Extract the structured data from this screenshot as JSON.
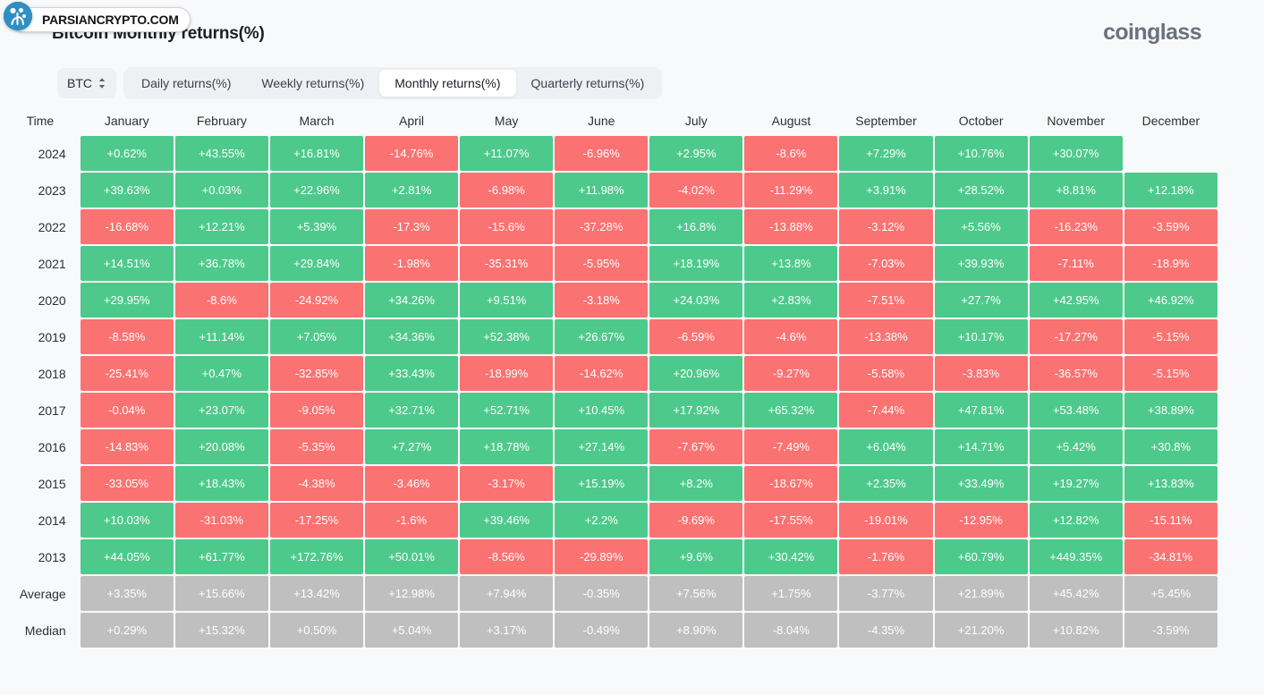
{
  "header": {
    "title": "Bitcoin Monthly returns(%)",
    "brand": "coinglass"
  },
  "watermark": {
    "text": "PARSIANCRYPTO.COM",
    "logo_icon": "tree-circle-icon"
  },
  "controls": {
    "asset": "BTC",
    "asset_chevron_icon": "chevron-up-down-icon",
    "tabs": [
      {
        "label": "Daily returns(%)",
        "active": false
      },
      {
        "label": "Weekly returns(%)",
        "active": false
      },
      {
        "label": "Monthly returns(%)",
        "active": true
      },
      {
        "label": "Quarterly returns(%)",
        "active": false
      }
    ]
  },
  "colors": {
    "positive": "#4ec98c",
    "negative": "#fa7272",
    "summary": "#bfbfbf",
    "background": "#f8f9fa",
    "text": "#2b3038"
  },
  "chart_data": {
    "type": "heatmap",
    "title": "Bitcoin Monthly returns(%)",
    "xlabel": "",
    "ylabel": "Time",
    "time_header": "Time",
    "categories": [
      "January",
      "February",
      "March",
      "April",
      "May",
      "June",
      "July",
      "August",
      "September",
      "October",
      "November",
      "December"
    ],
    "rows": [
      {
        "label": "2024",
        "kind": "year",
        "values": [
          "+0.62%",
          "+43.55%",
          "+16.81%",
          "-14.76%",
          "+11.07%",
          "-6.96%",
          "+2.95%",
          "-8.6%",
          "+7.29%",
          "+10.76%",
          "+30.07%",
          ""
        ]
      },
      {
        "label": "2023",
        "kind": "year",
        "values": [
          "+39.63%",
          "+0.03%",
          "+22.96%",
          "+2.81%",
          "-6.98%",
          "+11.98%",
          "-4.02%",
          "-11.29%",
          "+3.91%",
          "+28.52%",
          "+8.81%",
          "+12.18%"
        ]
      },
      {
        "label": "2022",
        "kind": "year",
        "values": [
          "-16.68%",
          "+12.21%",
          "+5.39%",
          "-17.3%",
          "-15.6%",
          "-37.28%",
          "+16.8%",
          "-13.88%",
          "-3.12%",
          "+5.56%",
          "-16.23%",
          "-3.59%"
        ]
      },
      {
        "label": "2021",
        "kind": "year",
        "values": [
          "+14.51%",
          "+36.78%",
          "+29.84%",
          "-1.98%",
          "-35.31%",
          "-5.95%",
          "+18.19%",
          "+13.8%",
          "-7.03%",
          "+39.93%",
          "-7.11%",
          "-18.9%"
        ]
      },
      {
        "label": "2020",
        "kind": "year",
        "values": [
          "+29.95%",
          "-8.6%",
          "-24.92%",
          "+34.26%",
          "+9.51%",
          "-3.18%",
          "+24.03%",
          "+2.83%",
          "-7.51%",
          "+27.7%",
          "+42.95%",
          "+46.92%"
        ]
      },
      {
        "label": "2019",
        "kind": "year",
        "values": [
          "-8.58%",
          "+11.14%",
          "+7.05%",
          "+34.36%",
          "+52.38%",
          "+26.67%",
          "-6.59%",
          "-4.6%",
          "-13.38%",
          "+10.17%",
          "-17.27%",
          "-5.15%"
        ]
      },
      {
        "label": "2018",
        "kind": "year",
        "values": [
          "-25.41%",
          "+0.47%",
          "-32.85%",
          "+33.43%",
          "-18.99%",
          "-14.62%",
          "+20.96%",
          "-9.27%",
          "-5.58%",
          "-3.83%",
          "-36.57%",
          "-5.15%"
        ]
      },
      {
        "label": "2017",
        "kind": "year",
        "values": [
          "-0.04%",
          "+23.07%",
          "-9.05%",
          "+32.71%",
          "+52.71%",
          "+10.45%",
          "+17.92%",
          "+65.32%",
          "-7.44%",
          "+47.81%",
          "+53.48%",
          "+38.89%"
        ]
      },
      {
        "label": "2016",
        "kind": "year",
        "values": [
          "-14.83%",
          "+20.08%",
          "-5.35%",
          "+7.27%",
          "+18.78%",
          "+27.14%",
          "-7.67%",
          "-7.49%",
          "+6.04%",
          "+14.71%",
          "+5.42%",
          "+30.8%"
        ]
      },
      {
        "label": "2015",
        "kind": "year",
        "values": [
          "-33.05%",
          "+18.43%",
          "-4.38%",
          "-3.46%",
          "-3.17%",
          "+15.19%",
          "+8.2%",
          "-18.67%",
          "+2.35%",
          "+33.49%",
          "+19.27%",
          "+13.83%"
        ]
      },
      {
        "label": "2014",
        "kind": "year",
        "values": [
          "+10.03%",
          "-31.03%",
          "-17.25%",
          "-1.6%",
          "+39.46%",
          "+2.2%",
          "-9.69%",
          "-17.55%",
          "-19.01%",
          "-12.95%",
          "+12.82%",
          "-15.11%"
        ]
      },
      {
        "label": "2013",
        "kind": "year",
        "values": [
          "+44.05%",
          "+61.77%",
          "+172.76%",
          "+50.01%",
          "-8.56%",
          "-29.89%",
          "+9.6%",
          "+30.42%",
          "-1.76%",
          "+60.79%",
          "+449.35%",
          "-34.81%"
        ]
      },
      {
        "label": "Average",
        "kind": "summary",
        "values": [
          "+3.35%",
          "+15.66%",
          "+13.42%",
          "+12.98%",
          "+7.94%",
          "-0.35%",
          "+7.56%",
          "+1.75%",
          "-3.77%",
          "+21.89%",
          "+45.42%",
          "+5.45%"
        ]
      },
      {
        "label": "Median",
        "kind": "summary",
        "values": [
          "+0.29%",
          "+15.32%",
          "+0.50%",
          "+5.04%",
          "+3.17%",
          "-0.49%",
          "+8.90%",
          "-8.04%",
          "-4.35%",
          "+21.20%",
          "+10.82%",
          "-3.59%"
        ]
      }
    ]
  }
}
